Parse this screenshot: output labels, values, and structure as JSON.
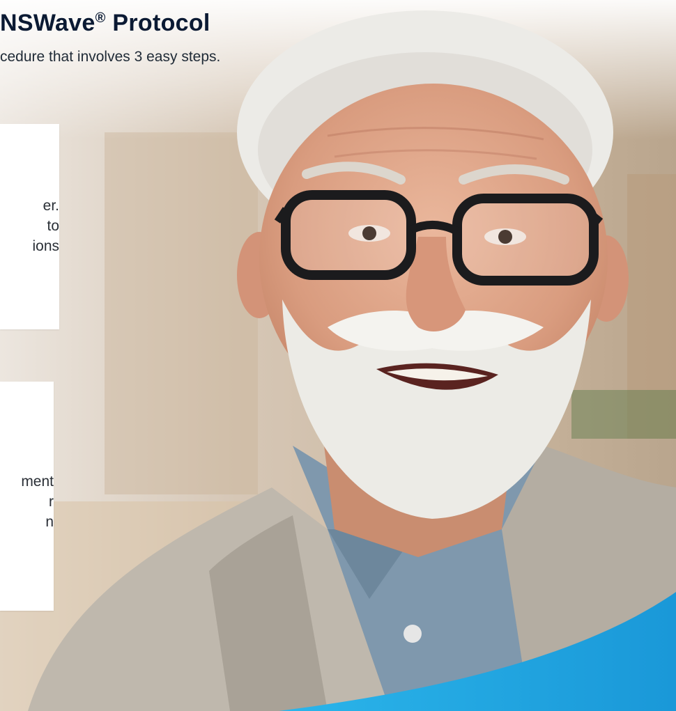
{
  "header": {
    "title": "NSWave",
    "title_mark": "®",
    "title_suffix": " Protocol",
    "subtitle": "cedure that involves 3 easy steps."
  },
  "step_card_1": {
    "fragments": [
      "er.",
      "to",
      "ions"
    ]
  },
  "step_card_2": {
    "fragments": [
      "ment",
      "r",
      "n"
    ]
  },
  "colors": {
    "headline": "#0b1a33",
    "body_text": "#2a2f36",
    "accent_wave": "#1fa3de",
    "card_bg": "#ffffff"
  },
  "photo": {
    "subject_icon": "smiling-man-photo-icon"
  }
}
